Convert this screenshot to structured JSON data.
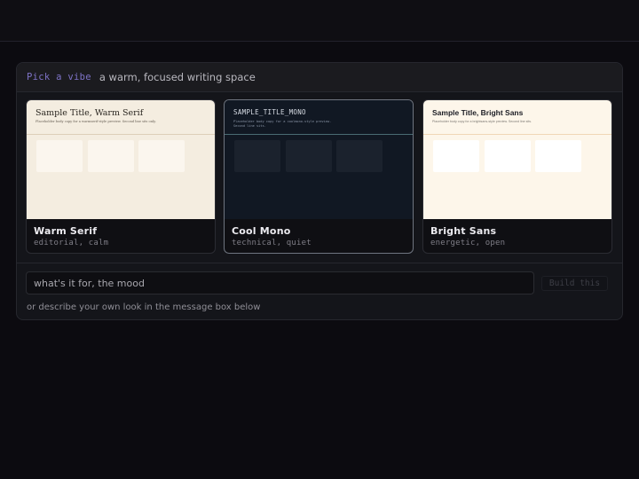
{
  "panel": {
    "kicker": "Pick a vibe",
    "headline": "a warm, focused writing space"
  },
  "cards": [
    {
      "name": "Warm Serif",
      "tags": "editorial, calm",
      "preview_title": "Sample Title, Warm Serif",
      "preview_body": "Placeholder body copy for a warmserif-style preview. Second line sits only."
    },
    {
      "name": "Cool Mono",
      "tags": "technical, quiet",
      "preview_title": "SAMPLE_TITLE_MONO",
      "preview_body": "Placeholder body copy for a coolmono-style preview.\nSecond line sits."
    },
    {
      "name": "Bright Sans",
      "tags": "energetic, open",
      "preview_title": "Sample Title, Bright Sans",
      "preview_body": "Placeholder body copy for a brightsans-style preview. Second line sits."
    }
  ],
  "mood_input": {
    "value": "",
    "placeholder": "what's it for, the mood"
  },
  "build_button": {
    "label": "Build this"
  },
  "hint": "or describe your own look in the message box below",
  "colors": {
    "accent": "#7d72c6",
    "background": "#0c0b10",
    "panel": "#14151a"
  }
}
